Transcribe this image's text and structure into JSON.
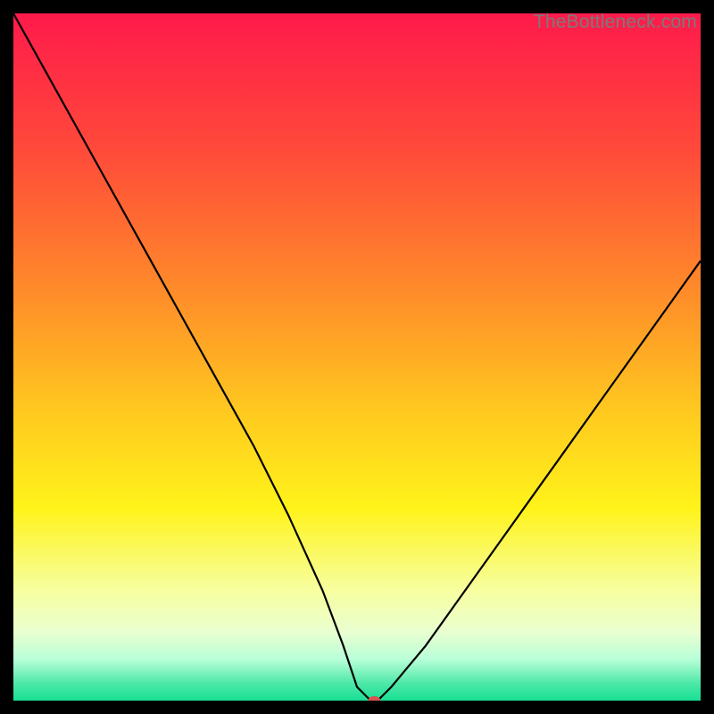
{
  "watermark": "TheBottleneck.com",
  "chart_data": {
    "type": "line",
    "title": "",
    "xlabel": "",
    "ylabel": "",
    "xlim": [
      0,
      100
    ],
    "ylim": [
      0,
      100
    ],
    "grid": false,
    "legend": false,
    "background": {
      "type": "vertical-gradient",
      "stops": [
        {
          "pos": 0.0,
          "color": "#ff1a4b"
        },
        {
          "pos": 0.2,
          "color": "#ff4a3a"
        },
        {
          "pos": 0.4,
          "color": "#ff8a2a"
        },
        {
          "pos": 0.58,
          "color": "#ffc91f"
        },
        {
          "pos": 0.72,
          "color": "#fff31a"
        },
        {
          "pos": 0.84,
          "color": "#f7ffa0"
        },
        {
          "pos": 0.9,
          "color": "#eaffd0"
        },
        {
          "pos": 0.94,
          "color": "#b8ffd8"
        },
        {
          "pos": 0.975,
          "color": "#4de8a8"
        },
        {
          "pos": 1.0,
          "color": "#18df94"
        }
      ]
    },
    "series": [
      {
        "name": "bottleneck-curve",
        "color": "#000000",
        "stroke_width": 2.2,
        "x": [
          0,
          5,
          10,
          15,
          20,
          25,
          30,
          35,
          40,
          45,
          48,
          50,
          52,
          53,
          55,
          60,
          65,
          70,
          75,
          80,
          85,
          90,
          95,
          100
        ],
        "values": [
          100,
          91,
          82,
          73,
          64,
          55,
          46,
          37,
          27,
          16,
          8,
          2,
          0,
          0,
          2,
          8,
          15,
          22,
          29,
          36,
          43,
          50,
          57,
          64
        ]
      }
    ],
    "marker": {
      "name": "optimal-point",
      "x": 52.5,
      "y": 0,
      "color": "#d9534f",
      "rx": 7,
      "ry": 5
    }
  }
}
